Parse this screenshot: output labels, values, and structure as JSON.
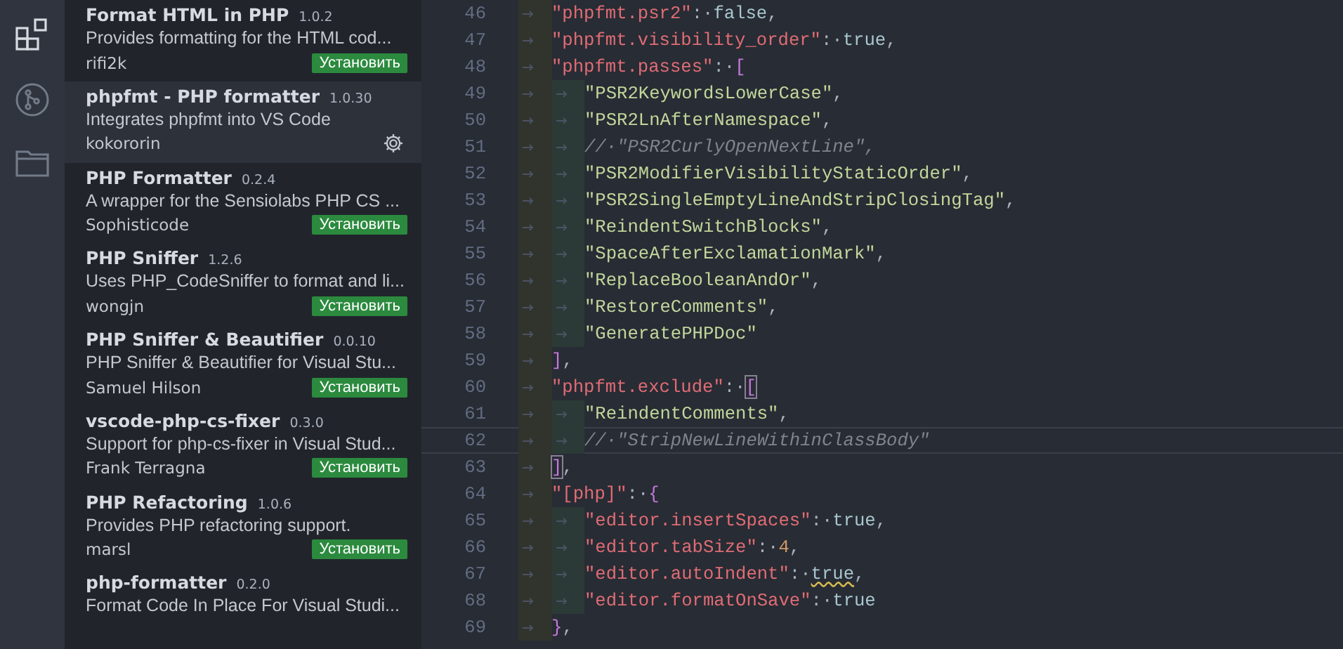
{
  "activity_bar": {
    "items": [
      {
        "kind": "extensions",
        "selected": true
      },
      {
        "kind": "source-control",
        "selected": false
      },
      {
        "kind": "explorer",
        "selected": false
      }
    ]
  },
  "extensions": [
    {
      "name": "Format HTML in PHP",
      "version": "1.0.2",
      "description": "Provides formatting for the HTML cod...",
      "author": "rifi2k",
      "installed": false,
      "selected": false,
      "action": "Установить"
    },
    {
      "name": "phpfmt - PHP formatter",
      "version": "1.0.30",
      "description": "Integrates phpfmt into VS Code",
      "author": "kokororin",
      "installed": true,
      "selected": true
    },
    {
      "name": "PHP Formatter",
      "version": "0.2.4",
      "description": "A wrapper for the Sensiolabs PHP CS ...",
      "author": "Sophisticode",
      "installed": false,
      "selected": false,
      "action": "Установить"
    },
    {
      "name": "PHP Sniffer",
      "version": "1.2.6",
      "description": "Uses PHP_CodeSniffer to format and li...",
      "author": "wongjn",
      "installed": false,
      "selected": false,
      "action": "Установить"
    },
    {
      "name": "PHP Sniffer & Beautifier",
      "version": "0.0.10",
      "description": "PHP Sniffer & Beautifier for Visual Stu...",
      "author": "Samuel Hilson",
      "installed": false,
      "selected": false,
      "action": "Установить"
    },
    {
      "name": "vscode-php-cs-fixer",
      "version": "0.3.0",
      "description": "Support for php-cs-fixer in Visual Stud...",
      "author": "Frank Terragna",
      "installed": false,
      "selected": false,
      "action": "Установить"
    },
    {
      "name": "PHP Refactoring",
      "version": "1.0.6",
      "description": "Provides PHP refactoring support.",
      "author": "marsl",
      "installed": false,
      "selected": false,
      "action": "Установить"
    },
    {
      "name": "php-formatter",
      "version": "0.2.0",
      "description": "Format Code In Place For Visual Studi...",
      "installed": false,
      "selected": false
    }
  ],
  "editor": {
    "lines": [
      {
        "number": "46",
        "current": false,
        "tokens": [
          {
            "kind": "tab"
          },
          {
            "kind": "key",
            "text": "\"phpfmt.psr2\""
          },
          {
            "kind": "punct",
            "text": ":·"
          },
          {
            "kind": "keyword",
            "text": "false"
          },
          {
            "kind": "punct",
            "text": ","
          }
        ]
      },
      {
        "number": "47",
        "current": false,
        "tokens": [
          {
            "kind": "tab"
          },
          {
            "kind": "key",
            "text": "\"phpfmt.visibility_order\""
          },
          {
            "kind": "punct",
            "text": ":·"
          },
          {
            "kind": "keyword",
            "text": "true"
          },
          {
            "kind": "punct",
            "text": ","
          }
        ]
      },
      {
        "number": "48",
        "current": false,
        "tokens": [
          {
            "kind": "tab"
          },
          {
            "kind": "key",
            "text": "\"phpfmt.passes\""
          },
          {
            "kind": "punct",
            "text": ":·"
          },
          {
            "kind": "bracket",
            "text": "["
          }
        ]
      },
      {
        "number": "49",
        "current": false,
        "tokens": [
          {
            "kind": "tab"
          },
          {
            "kind": "tab"
          },
          {
            "kind": "string",
            "text": "\"PSR2KeywordsLowerCase\""
          },
          {
            "kind": "punct",
            "text": ","
          }
        ]
      },
      {
        "number": "50",
        "current": false,
        "tokens": [
          {
            "kind": "tab"
          },
          {
            "kind": "tab"
          },
          {
            "kind": "string",
            "text": "\"PSR2LnAfterNamespace\""
          },
          {
            "kind": "punct",
            "text": ","
          }
        ]
      },
      {
        "number": "51",
        "current": false,
        "tokens": [
          {
            "kind": "tab"
          },
          {
            "kind": "tab"
          },
          {
            "kind": "comment",
            "text": "//·\"PSR2CurlyOpenNextLine\","
          }
        ]
      },
      {
        "number": "52",
        "current": false,
        "tokens": [
          {
            "kind": "tab"
          },
          {
            "kind": "tab"
          },
          {
            "kind": "string",
            "text": "\"PSR2ModifierVisibilityStaticOrder\""
          },
          {
            "kind": "punct",
            "text": ","
          }
        ]
      },
      {
        "number": "53",
        "current": false,
        "tokens": [
          {
            "kind": "tab"
          },
          {
            "kind": "tab"
          },
          {
            "kind": "string",
            "text": "\"PSR2SingleEmptyLineAndStripClosingTag\""
          },
          {
            "kind": "punct",
            "text": ","
          }
        ]
      },
      {
        "number": "54",
        "current": false,
        "tokens": [
          {
            "kind": "tab"
          },
          {
            "kind": "tab"
          },
          {
            "kind": "string",
            "text": "\"ReindentSwitchBlocks\""
          },
          {
            "kind": "punct",
            "text": ","
          }
        ]
      },
      {
        "number": "55",
        "current": false,
        "tokens": [
          {
            "kind": "tab"
          },
          {
            "kind": "tab"
          },
          {
            "kind": "string",
            "text": "\"SpaceAfterExclamationMark\""
          },
          {
            "kind": "punct",
            "text": ","
          }
        ]
      },
      {
        "number": "56",
        "current": false,
        "tokens": [
          {
            "kind": "tab"
          },
          {
            "kind": "tab"
          },
          {
            "kind": "string",
            "text": "\"ReplaceBooleanAndOr\""
          },
          {
            "kind": "punct",
            "text": ","
          }
        ]
      },
      {
        "number": "57",
        "current": false,
        "tokens": [
          {
            "kind": "tab"
          },
          {
            "kind": "tab"
          },
          {
            "kind": "string",
            "text": "\"RestoreComments\""
          },
          {
            "kind": "punct",
            "text": ","
          }
        ]
      },
      {
        "number": "58",
        "current": false,
        "tokens": [
          {
            "kind": "tab"
          },
          {
            "kind": "tab"
          },
          {
            "kind": "string",
            "text": "\"GeneratePHPDoc\""
          }
        ]
      },
      {
        "number": "59",
        "current": false,
        "tokens": [
          {
            "kind": "tab"
          },
          {
            "kind": "bracket",
            "text": "]"
          },
          {
            "kind": "punct",
            "text": ","
          }
        ]
      },
      {
        "number": "60",
        "current": false,
        "tokens": [
          {
            "kind": "tab"
          },
          {
            "kind": "key",
            "text": "\"phpfmt.exclude\""
          },
          {
            "kind": "punct",
            "text": ":·"
          },
          {
            "kind": "bracket-match",
            "text": "["
          }
        ]
      },
      {
        "number": "61",
        "current": false,
        "tokens": [
          {
            "kind": "tab"
          },
          {
            "kind": "tab"
          },
          {
            "kind": "string",
            "text": "\"ReindentComments\""
          },
          {
            "kind": "punct",
            "text": ","
          }
        ]
      },
      {
        "number": "62",
        "current": true,
        "tokens": [
          {
            "kind": "tab"
          },
          {
            "kind": "tab"
          },
          {
            "kind": "comment",
            "text": "//·\"StripNewLineWithinClassBody\""
          }
        ]
      },
      {
        "number": "63",
        "current": false,
        "tokens": [
          {
            "kind": "tab"
          },
          {
            "kind": "bracket-match",
            "text": "]"
          },
          {
            "kind": "punct",
            "text": ","
          }
        ]
      },
      {
        "number": "64",
        "current": false,
        "tokens": [
          {
            "kind": "tab"
          },
          {
            "kind": "key",
            "text": "\"[php]\""
          },
          {
            "kind": "punct",
            "text": ":·"
          },
          {
            "kind": "bracket",
            "text": "{"
          }
        ]
      },
      {
        "number": "65",
        "current": false,
        "tokens": [
          {
            "kind": "tab"
          },
          {
            "kind": "tab"
          },
          {
            "kind": "key",
            "text": "\"editor.insertSpaces\""
          },
          {
            "kind": "punct",
            "text": ":·"
          },
          {
            "kind": "keyword",
            "text": "true"
          },
          {
            "kind": "punct",
            "text": ","
          }
        ]
      },
      {
        "number": "66",
        "current": false,
        "tokens": [
          {
            "kind": "tab"
          },
          {
            "kind": "tab"
          },
          {
            "kind": "key",
            "text": "\"editor.tabSize\""
          },
          {
            "kind": "punct",
            "text": ":·"
          },
          {
            "kind": "number",
            "text": "4"
          },
          {
            "kind": "punct",
            "text": ","
          }
        ]
      },
      {
        "number": "67",
        "current": false,
        "tokens": [
          {
            "kind": "tab"
          },
          {
            "kind": "tab"
          },
          {
            "kind": "key",
            "text": "\"editor.autoIndent\""
          },
          {
            "kind": "punct",
            "text": ":·"
          },
          {
            "kind": "keyword-warning",
            "text": "true"
          },
          {
            "kind": "punct",
            "text": ","
          }
        ]
      },
      {
        "number": "68",
        "current": false,
        "tokens": [
          {
            "kind": "tab"
          },
          {
            "kind": "tab"
          },
          {
            "kind": "key",
            "text": "\"editor.formatOnSave\""
          },
          {
            "kind": "punct",
            "text": ":·"
          },
          {
            "kind": "keyword",
            "text": "true"
          }
        ]
      },
      {
        "number": "69",
        "current": false,
        "tokens": [
          {
            "kind": "tab"
          },
          {
            "kind": "bracket",
            "text": "}"
          },
          {
            "kind": "punct",
            "text": ","
          }
        ]
      }
    ]
  }
}
